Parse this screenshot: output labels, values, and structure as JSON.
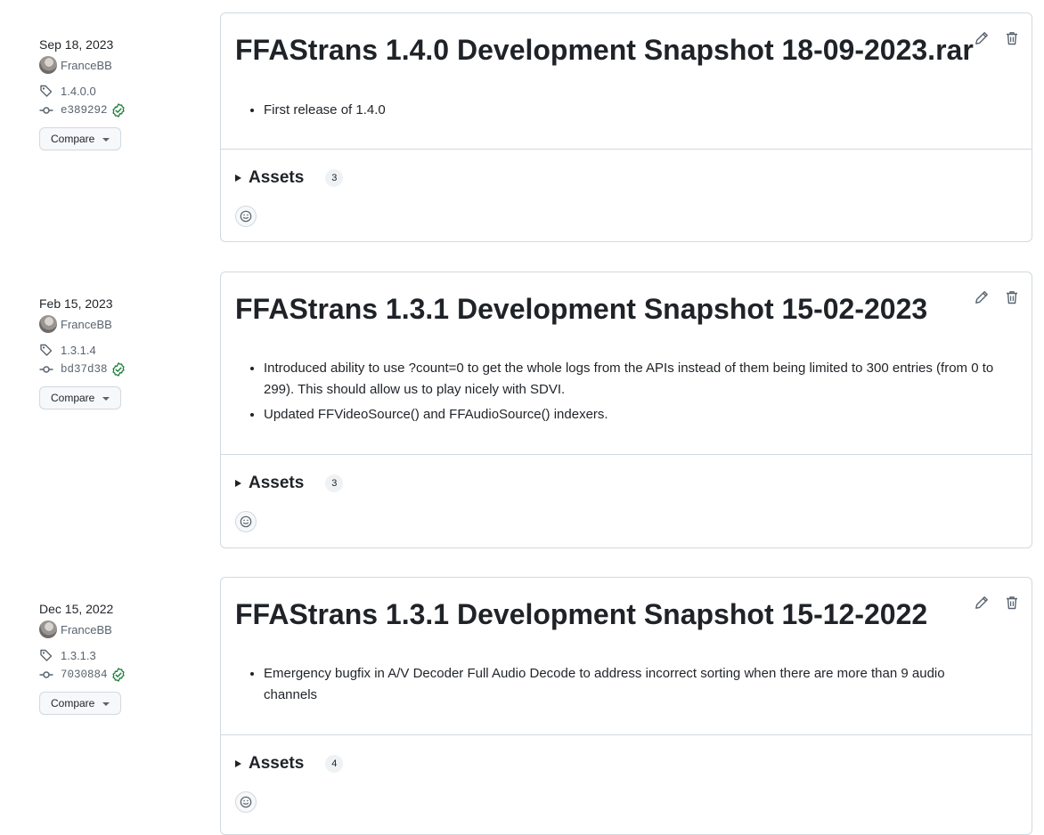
{
  "releases": [
    {
      "date": "Sep 18, 2023",
      "author": "FranceBB",
      "tag": "1.4.0.0",
      "commit": "e389292",
      "compare_label": "Compare",
      "title": "FFAStrans 1.4.0 Development Snapshot 18-09-2023.rar",
      "notes": [
        "First release of 1.4.0"
      ],
      "assets_label": "Assets",
      "assets_count": "3"
    },
    {
      "date": "Feb 15, 2023",
      "author": "FranceBB",
      "tag": "1.3.1.4",
      "commit": "bd37d38",
      "compare_label": "Compare",
      "title": "FFAStrans 1.3.1 Development Snapshot 15-02-2023",
      "notes": [
        "Introduced ability to use ?count=0 to get the whole logs from the APIs instead of them being limited to 300 entries (from 0 to 299). This should allow us to play nicely with SDVI.",
        "Updated FFVideoSource() and FFAudioSource() indexers."
      ],
      "assets_label": "Assets",
      "assets_count": "3"
    },
    {
      "date": "Dec 15, 2022",
      "author": "FranceBB",
      "tag": "1.3.1.3",
      "commit": "7030884",
      "compare_label": "Compare",
      "title": "FFAStrans 1.3.1 Development Snapshot 15-12-2022",
      "notes": [
        "Emergency bugfix in A/V Decoder Full Audio Decode to address incorrect sorting when there are more than 9 audio channels"
      ],
      "assets_label": "Assets",
      "assets_count": "4"
    }
  ],
  "icons": {
    "tag": "tag-icon",
    "commit": "git-commit-icon",
    "verified": "verified-check-icon",
    "edit": "pencil-icon",
    "delete": "trash-icon",
    "reaction": "smiley-icon"
  },
  "colors": {
    "verified": "#1a7f37",
    "muted": "#59636e",
    "border": "#d1d9e0"
  }
}
